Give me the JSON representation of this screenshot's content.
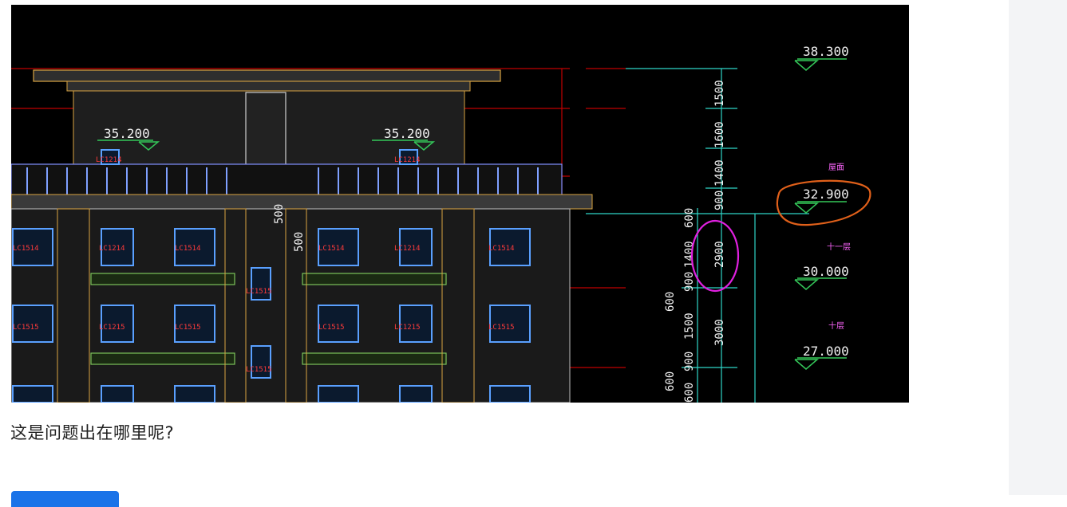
{
  "post": {
    "question": "这是问题出在哪里呢?",
    "cad_drawing": {
      "elevations": [
        "38.300",
        "35.200",
        "35.200",
        "32.900",
        "30.000",
        "27.000"
      ],
      "floor_labels": [
        "屋面",
        "十一层",
        "十层"
      ],
      "dimensions_right": [
        "1500",
        "1600",
        "1400",
        "900",
        "600",
        "2900",
        "1400",
        "900",
        "1500",
        "3000",
        "900",
        "600",
        "500",
        "500",
        "600",
        "600"
      ],
      "window_tags": [
        "LC1214",
        "LC1214",
        "LC1514",
        "LC1214",
        "LC1514",
        "LC1514",
        "LC1214",
        "LC1514",
        "LC1515",
        "LC1215",
        "LC1515",
        "LC1515",
        "LC1215",
        "LC1515",
        "LC1515",
        "LC1515"
      ],
      "highlight_colors": {
        "orange": "#e0601a",
        "magenta": "#e020e0",
        "green": "#34c759",
        "cyan": "#2fd6c8"
      }
    }
  }
}
